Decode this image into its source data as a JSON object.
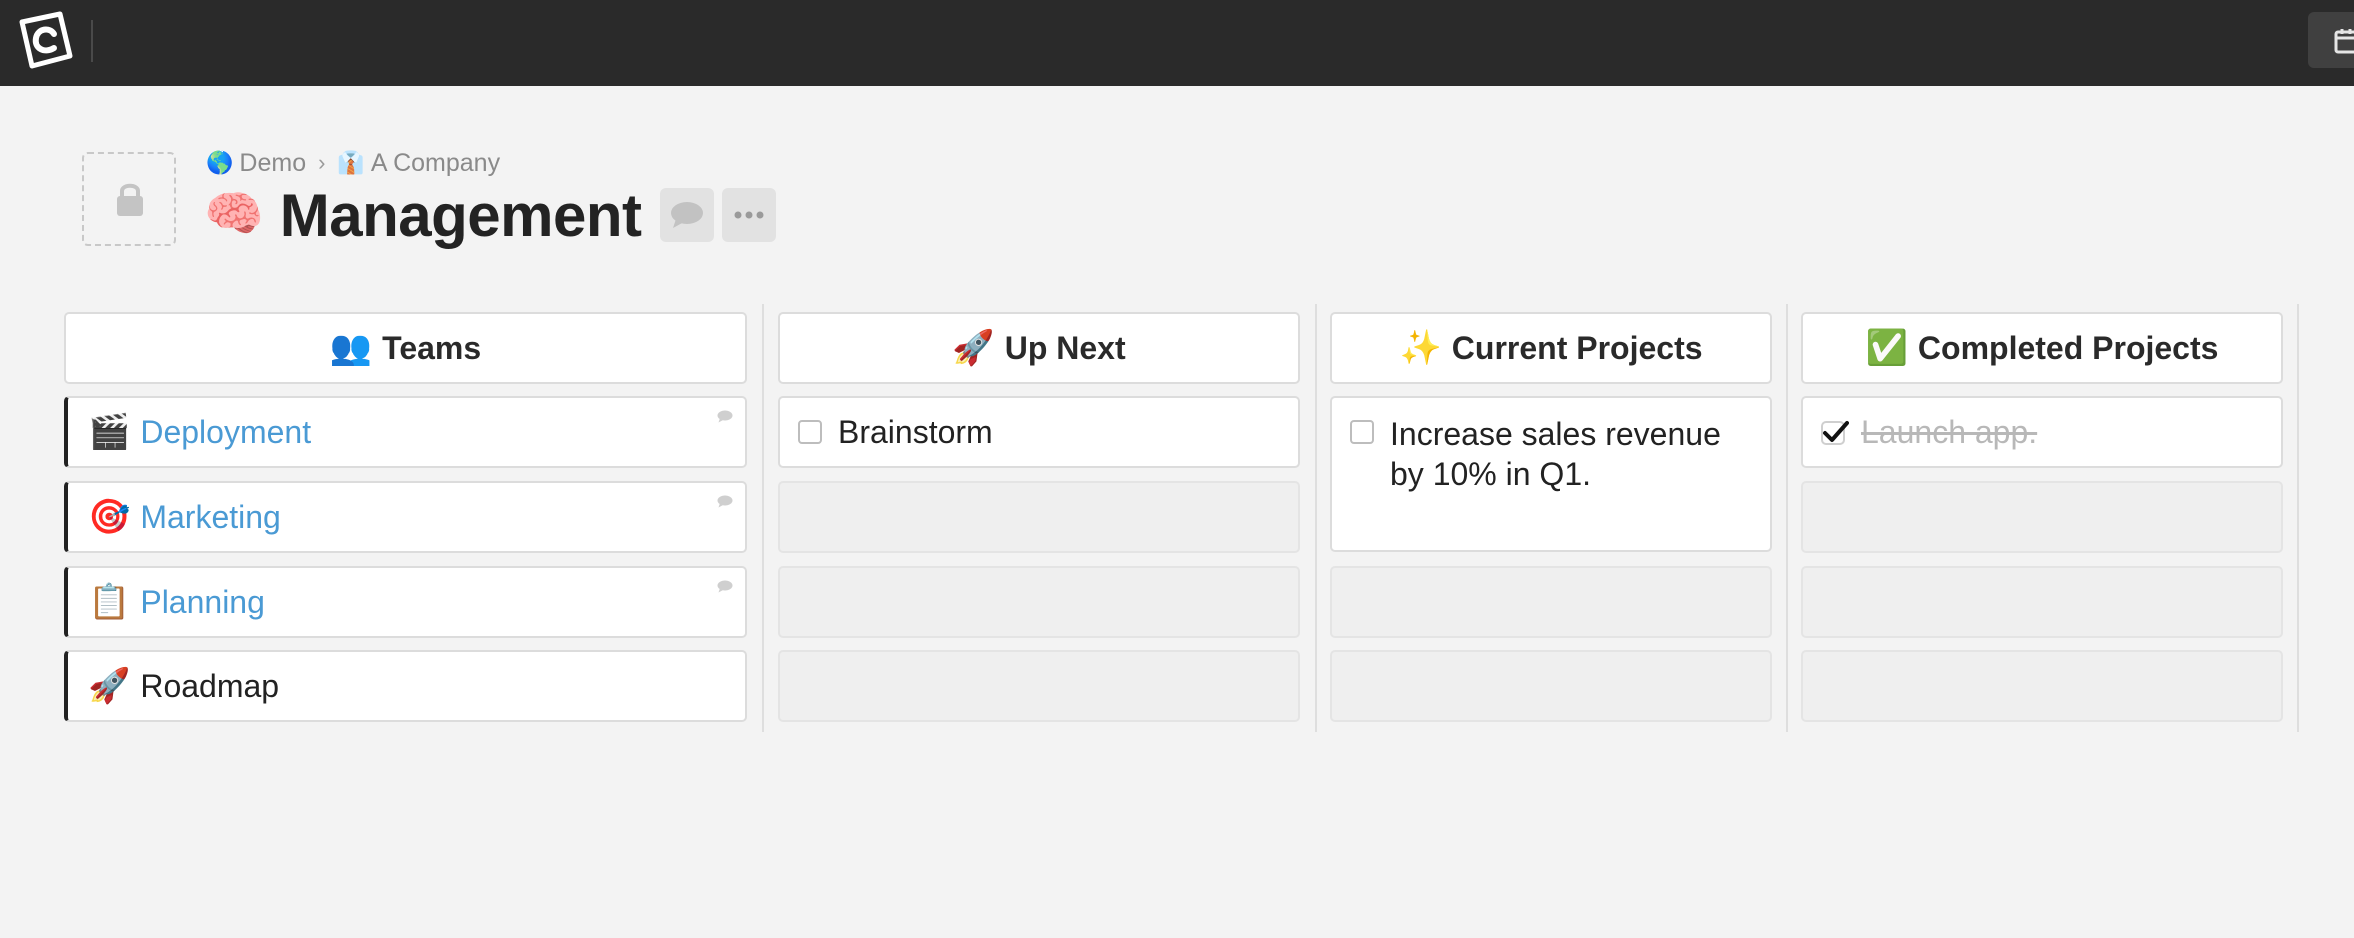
{
  "app": {
    "logo_icon": "cartan-logo",
    "right_button_icon": "calendar-icon"
  },
  "header": {
    "breadcrumb": [
      {
        "emoji": "🌎",
        "label": "Demo"
      },
      {
        "emoji": "👔",
        "label": "A Company"
      }
    ],
    "separator": "›",
    "title_emoji": "🧠",
    "title": "Management",
    "lock_icon": "lock-icon",
    "comment_icon": "speech-bubble-icon",
    "more_icon": "ellipsis-icon"
  },
  "board": {
    "columns": [
      {
        "emoji": "👥",
        "title": "Teams",
        "cards": [
          {
            "emoji": "🎬",
            "label": "Deployment",
            "link": true,
            "has_comments": true
          },
          {
            "emoji": "🎯",
            "label": "Marketing",
            "link": true,
            "has_comments": true
          },
          {
            "emoji": "📋",
            "label": "Planning",
            "link": true,
            "has_comments": true
          },
          {
            "emoji": "🚀",
            "label": "Roadmap",
            "link": false,
            "has_comments": false
          }
        ]
      },
      {
        "emoji": "🚀",
        "title": "Up Next",
        "cards": [
          {
            "label": "Brainstorm",
            "checked": false
          }
        ]
      },
      {
        "emoji": "✨",
        "title": "Current Projects",
        "cards": [
          {
            "label": "Increase sales revenue by 10% in Q1.",
            "checked": false
          }
        ]
      },
      {
        "emoji": "✅",
        "title": "Completed Projects",
        "cards": [
          {
            "label": "Launch app.",
            "checked": true
          }
        ]
      }
    ]
  },
  "colors": {
    "topbar": "#2a2a2a",
    "background": "#f3f3f3",
    "link": "#4a9ad4",
    "done_text": "#b8b8b8"
  }
}
